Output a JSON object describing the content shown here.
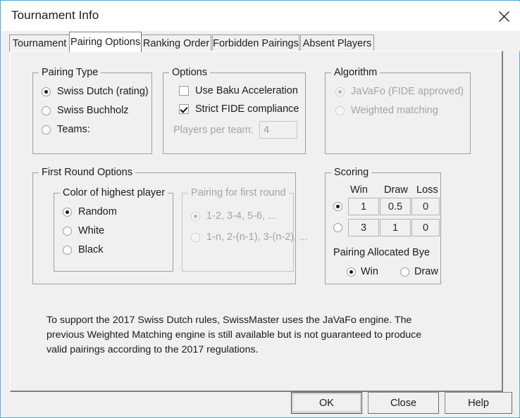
{
  "window": {
    "title": "Tournament Info",
    "close_icon": "close-icon"
  },
  "tabs": [
    {
      "label": "Tournament",
      "selected": false
    },
    {
      "label": "Pairing Options",
      "selected": true
    },
    {
      "label": "Ranking Order",
      "selected": false
    },
    {
      "label": "Forbidden Pairings",
      "selected": false
    },
    {
      "label": "Absent Players",
      "selected": false
    }
  ],
  "pairing_type": {
    "legend": "Pairing Type",
    "options": [
      {
        "label": "Swiss Dutch (rating)",
        "checked": true
      },
      {
        "label": "Swiss Buchholz",
        "checked": false
      },
      {
        "label": "Teams:",
        "checked": false
      }
    ]
  },
  "options": {
    "legend": "Options",
    "checkboxes": [
      {
        "label": "Use Baku Acceleration",
        "checked": false
      },
      {
        "label": "Strict FIDE compliance",
        "checked": true
      }
    ],
    "players_per_team_label": "Players per team:",
    "players_per_team_value": "4",
    "players_per_team_disabled": true
  },
  "algorithm": {
    "legend": "Algorithm",
    "disabled": true,
    "options": [
      {
        "label": "JaVaFo (FIDE approved)",
        "checked": true
      },
      {
        "label": "Weighted matching",
        "checked": false
      }
    ]
  },
  "first_round": {
    "legend": "First Round Options",
    "color_group": {
      "legend": "Color of highest player",
      "options": [
        {
          "label": "Random",
          "checked": true
        },
        {
          "label": "White",
          "checked": false
        },
        {
          "label": "Black",
          "checked": false
        }
      ]
    },
    "pairing_group": {
      "legend": "Pairing for first round",
      "disabled": true,
      "options": [
        {
          "label": "1-2, 3-4, 5-6, ...",
          "checked": true
        },
        {
          "label": "1-n, 2-(n-1), 3-(n-2), ...",
          "checked": false
        }
      ]
    }
  },
  "scoring": {
    "legend": "Scoring",
    "headers": [
      "Win",
      "Draw",
      "Loss"
    ],
    "rows": [
      {
        "selected": true,
        "win": "1",
        "draw": "0.5",
        "loss": "0"
      },
      {
        "selected": false,
        "win": "3",
        "draw": "1",
        "loss": "0"
      }
    ],
    "bye_label": "Pairing Allocated Bye",
    "bye_options": [
      {
        "label": "Win",
        "checked": true
      },
      {
        "label": "Draw",
        "checked": false
      }
    ]
  },
  "note": "To support the 2017 Swiss Dutch rules, SwissMaster uses the JaVaFo engine. The previous Weighted Matching engine is still available but is not guaranteed to produce valid pairings according to the 2017 regulations.",
  "buttons": {
    "ok": "OK",
    "close": "Close",
    "help": "Help"
  },
  "colors": {
    "window_border": "#4db2e4",
    "dialog_bg": "#f0f0f0",
    "titlebar_bg": "#ffffff",
    "text": "#1b1b1b",
    "disabled_text": "#a4a4a4"
  }
}
